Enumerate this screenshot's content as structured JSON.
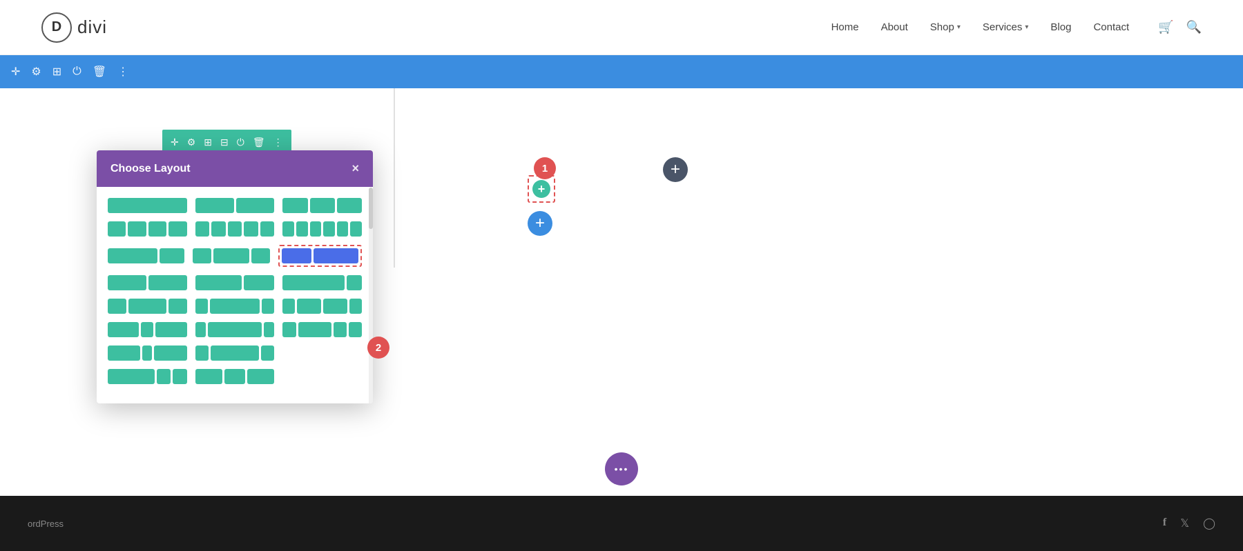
{
  "header": {
    "logo_letter": "D",
    "logo_text": "divi",
    "nav": [
      {
        "label": "Home",
        "has_chevron": false
      },
      {
        "label": "About",
        "has_chevron": false
      },
      {
        "label": "Shop",
        "has_chevron": true
      },
      {
        "label": "Services",
        "has_chevron": true
      },
      {
        "label": "Blog",
        "has_chevron": false
      },
      {
        "label": "Contact",
        "has_chevron": false
      }
    ]
  },
  "toolbar": {
    "icons": [
      "➕",
      "⚙",
      "⊞",
      "⏻",
      "🗑",
      "⋮"
    ]
  },
  "section_toolbar": {
    "icons": [
      "✛",
      "⚙",
      "⊞",
      "⊟",
      "⏻",
      "🗑",
      "⋮"
    ]
  },
  "modal": {
    "title": "Choose Layout",
    "close_label": "×"
  },
  "badges": {
    "one": "1",
    "two": "2"
  },
  "footer": {
    "text": "ordPress",
    "social_icons": [
      "f",
      "𝕋",
      "○"
    ]
  },
  "bottom_dots": "•••"
}
